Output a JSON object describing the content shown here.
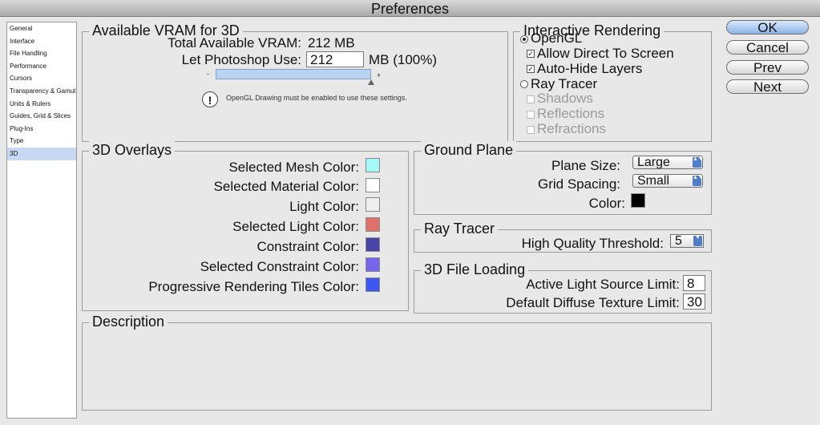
{
  "window": {
    "title": "Preferences"
  },
  "sidebar": {
    "items": [
      "General",
      "Interface",
      "File Handling",
      "Performance",
      "Cursors",
      "Transparency & Gamut",
      "Units & Rulers",
      "Guides, Grid & Slices",
      "Plug-Ins",
      "Type",
      "3D"
    ],
    "selected": "3D"
  },
  "vram": {
    "title": "Available VRAM for 3D",
    "total_label": "Total Available VRAM:",
    "total_value": "212 MB",
    "let_label": "Let Photoshop Use:",
    "let_value": "212",
    "let_unit": "MB (100%)",
    "slider_min": "-",
    "slider_max": "+",
    "slider_value": 1.0,
    "note": "OpenGL Drawing must be enabled to use these settings.",
    "warn_icon": "!"
  },
  "interactive": {
    "title": "Interactive Rendering",
    "opengl": "OpenGL",
    "allow_direct": "Allow Direct To Screen",
    "auto_hide": "Auto-Hide Layers",
    "ray_tracer": "Ray Tracer",
    "shadows": "Shadows",
    "reflections": "Reflections",
    "refractions": "Refractions",
    "check": "✓"
  },
  "overlays": {
    "title": "3D Overlays",
    "items": [
      {
        "label": "Selected Mesh Color:",
        "color": "#a6f7f7"
      },
      {
        "label": "Selected Material Color:",
        "color": "#ffffff"
      },
      {
        "label": "Light Color:",
        "color": "#eeeeee"
      },
      {
        "label": "Selected Light Color:",
        "color": "#e0706a"
      },
      {
        "label": "Constraint Color:",
        "color": "#4a43a8"
      },
      {
        "label": "Selected Constraint Color:",
        "color": "#7366ea"
      },
      {
        "label": "Progressive Rendering Tiles Color:",
        "color": "#3e55f2"
      }
    ]
  },
  "ground": {
    "title": "Ground Plane",
    "plane_size_label": "Plane Size:",
    "plane_size_value": "Large",
    "grid_spacing_label": "Grid Spacing:",
    "grid_spacing_value": "Small",
    "color_label": "Color:",
    "color": "#000000"
  },
  "raytracer": {
    "title": "Ray Tracer",
    "threshold_label": "High Quality Threshold:",
    "threshold_value": "5"
  },
  "fileloading": {
    "title": "3D File Loading",
    "light_label": "Active Light Source Limit:",
    "light_value": "8",
    "texture_label": "Default Diffuse Texture Limit:",
    "texture_value": "30"
  },
  "description": {
    "title": "Description"
  },
  "buttons": {
    "ok": "OK",
    "cancel": "Cancel",
    "prev": "Prev",
    "next": "Next"
  },
  "arrows": {
    "updown": "▲▼",
    "down": "▼"
  }
}
